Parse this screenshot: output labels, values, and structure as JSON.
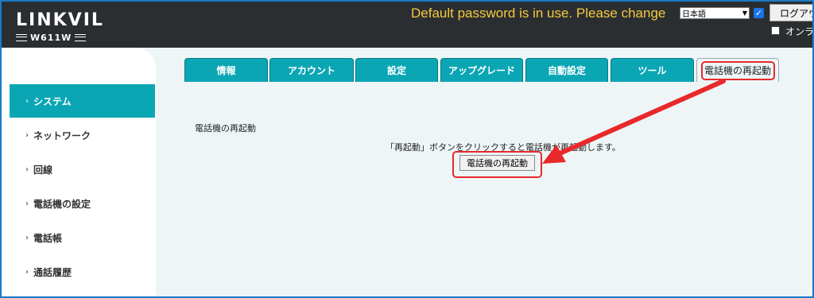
{
  "header": {
    "logo_main": "LINKVIL",
    "logo_model": "W611W",
    "warning": "Default password is in use. Please change",
    "language_select": "日本語",
    "logout_label": "ログアウ",
    "online_label": "オンライ",
    "warning_color": "#f5c93c"
  },
  "tabs": [
    {
      "label": "情報"
    },
    {
      "label": "アカウント"
    },
    {
      "label": "設定"
    },
    {
      "label": "アップグレード"
    },
    {
      "label": "自動設定"
    },
    {
      "label": "ツール"
    },
    {
      "label": "電話機の再起動"
    }
  ],
  "sidebar": {
    "items": [
      {
        "label": "システム"
      },
      {
        "label": "ネットワーク"
      },
      {
        "label": "回線"
      },
      {
        "label": "電話機の設定"
      },
      {
        "label": "電話帳"
      },
      {
        "label": "通話履歴"
      }
    ]
  },
  "main": {
    "section_title": "電話機の再起動",
    "description": "「再起動」ボタンをクリックすると電話機が再起動します。",
    "reboot_button": "電話機の再起動"
  },
  "colors": {
    "accent": "#0ba6b4",
    "annotation": "#e8292b",
    "header_bg": "#2a2e31"
  }
}
